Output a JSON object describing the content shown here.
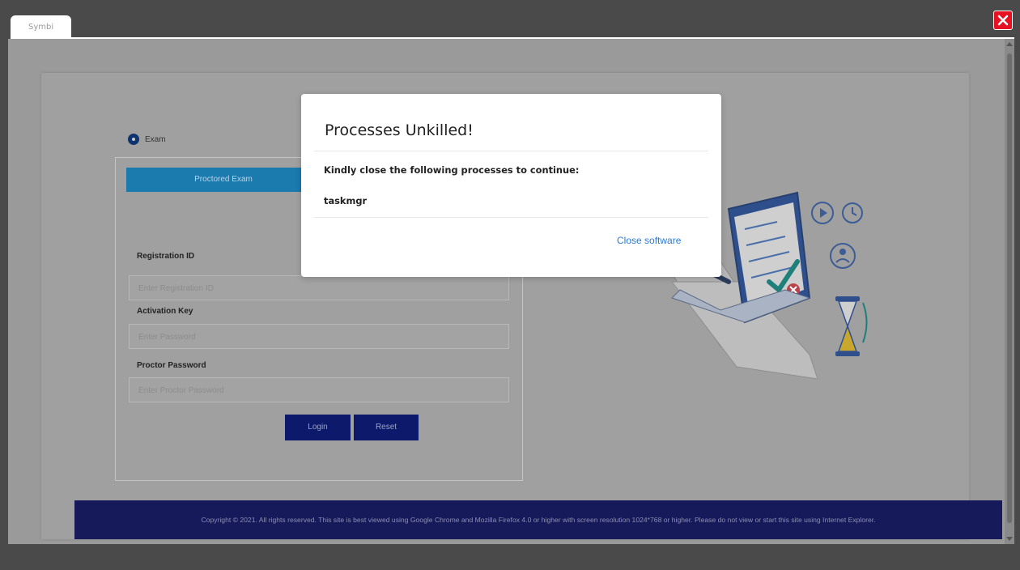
{
  "window": {
    "tab_label": "Symbi",
    "close_icon": "close-icon",
    "close_color": "#e81123"
  },
  "form": {
    "radio_label": "Exam",
    "tab_label": "Proctored Exam",
    "registration_label": "Registration ID",
    "registration_placeholder": "Enter Registration ID",
    "activation_label": "Activation Key",
    "activation_placeholder": "Enter Password",
    "proctor_label": "Proctor Password",
    "proctor_placeholder": "Enter Proctor Password",
    "login_label": "Login",
    "reset_label": "Reset"
  },
  "footer": {
    "text": "Copyright © 2021. All rights reserved. This site is best viewed using Google Chrome and Mozilla Firefox 4.0 or higher with screen resolution 1024*768 or higher. Please do not view or start this site using Internet Explorer."
  },
  "modal": {
    "title": "Processes Unkilled!",
    "message": "Kindly close the following processes to continue:",
    "process": "taskmgr",
    "action_label": "Close software"
  },
  "colors": {
    "primary_button": "#0d1a6b",
    "tab_active": "#1b7aae",
    "footer_bg": "#16195a",
    "link": "#2a7bd4"
  },
  "illustration": "exam-checklist-illustration"
}
